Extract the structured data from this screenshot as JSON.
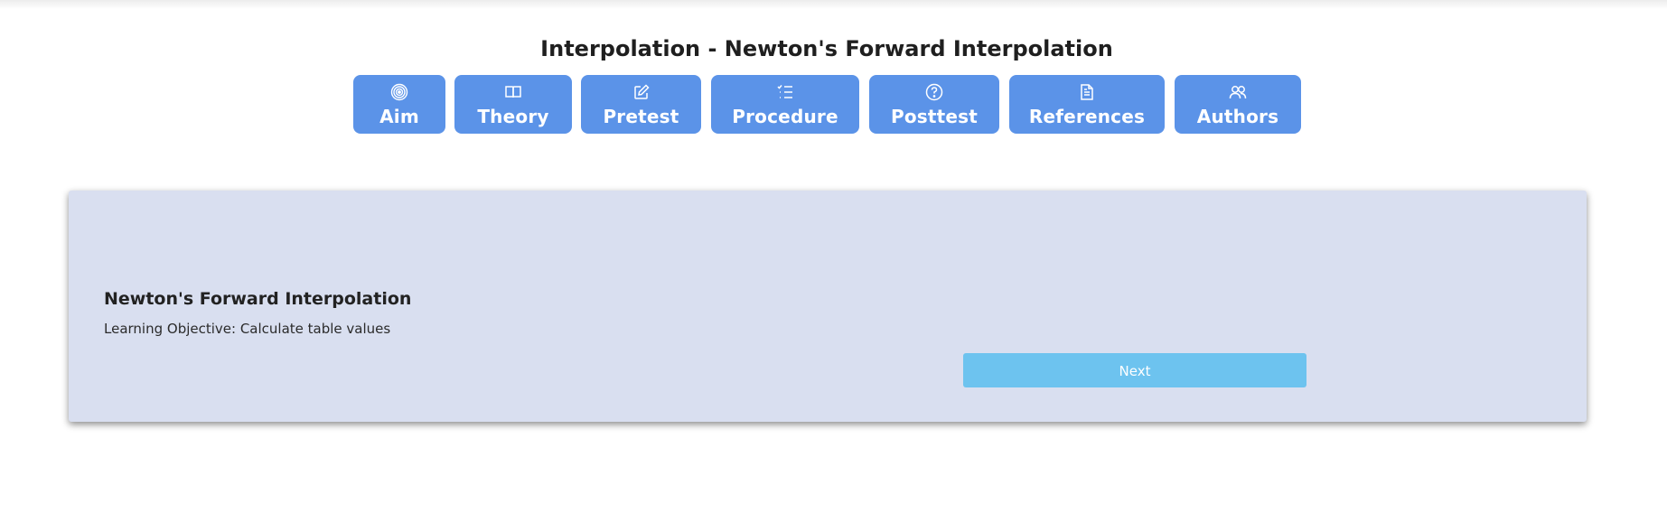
{
  "page": {
    "title": "Interpolation - Newton's Forward Interpolation"
  },
  "tabs": [
    {
      "label": "Aim",
      "icon": "target-icon"
    },
    {
      "label": "Theory",
      "icon": "book-icon"
    },
    {
      "label": "Pretest",
      "icon": "edit-icon"
    },
    {
      "label": "Procedure",
      "icon": "checklist-icon"
    },
    {
      "label": "Posttest",
      "icon": "question-circle-icon"
    },
    {
      "label": "References",
      "icon": "document-icon"
    },
    {
      "label": "Authors",
      "icon": "people-icon"
    }
  ],
  "card": {
    "title": "Newton's Forward Interpolation",
    "objective": "Learning Objective: Calculate table values",
    "next_label": "Next"
  },
  "colors": {
    "tab_bg": "#5b93e8",
    "card_bg": "#d9dff0",
    "next_bg": "#6dc3ef"
  }
}
